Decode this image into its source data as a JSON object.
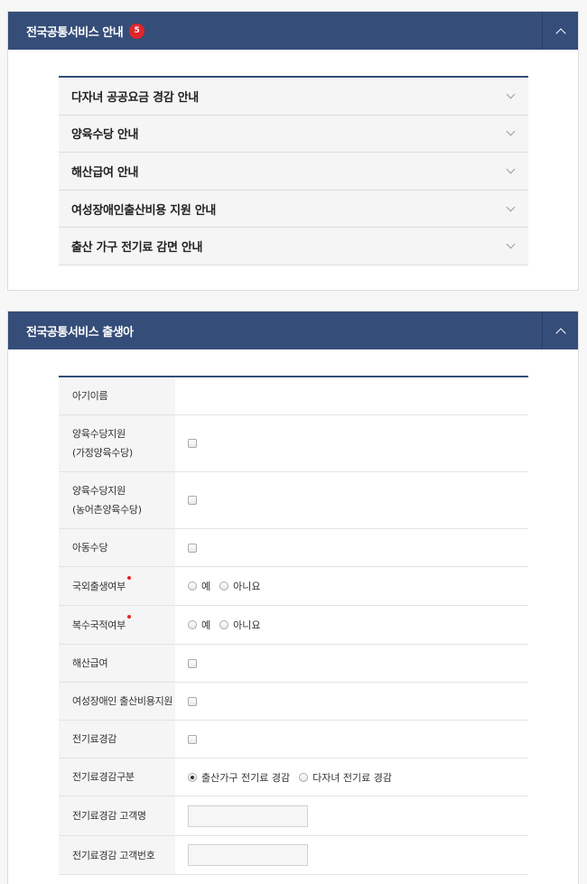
{
  "panel1": {
    "title": "전국공통서비스 안내",
    "badge": "5",
    "items": [
      {
        "label": "다자녀 공공요금 경감 안내"
      },
      {
        "label": "양육수당 안내"
      },
      {
        "label": "해산급여 안내"
      },
      {
        "label": "여성장애인출산비용 지원 안내"
      },
      {
        "label": "출산 가구 전기료 감면 안내"
      }
    ]
  },
  "panel2": {
    "title": "전국공통서비스 출생아",
    "rows": {
      "baby_name": {
        "label": "아기이름"
      },
      "childcare_home": {
        "line1": "양육수당지원",
        "line2": "(가정양육수당)"
      },
      "childcare_farm": {
        "line1": "양육수당지원",
        "line2": "(농어촌양육수당)"
      },
      "child_allowance": {
        "label": "아동수당"
      },
      "foreign_birth": {
        "label": "국외출생여부",
        "opt_yes": "예",
        "opt_no": "아니요"
      },
      "multi_nationality": {
        "label": "복수국적여부",
        "opt_yes": "예",
        "opt_no": "아니요"
      },
      "maternity_benefit": {
        "label": "해산급여"
      },
      "disabled_women": {
        "label": "여성장애인 출산비용지원"
      },
      "electricity": {
        "label": "전기료경감"
      },
      "electricity_type": {
        "label": "전기료경감구분",
        "opt_a": "출산가구 전기료 경감",
        "opt_b": "다자녀 전기료 경감",
        "selected": "출산가구 전기료 경감"
      },
      "customer_name": {
        "label": "전기료경감 고객명",
        "value": ""
      },
      "customer_number": {
        "label": "전기료경감 고객번호",
        "value": ""
      }
    }
  },
  "colors": {
    "header": "#354d79",
    "badge": "#e1262a",
    "required_dot": "#e1262a",
    "row_label_bg": "#f5f5f5"
  }
}
